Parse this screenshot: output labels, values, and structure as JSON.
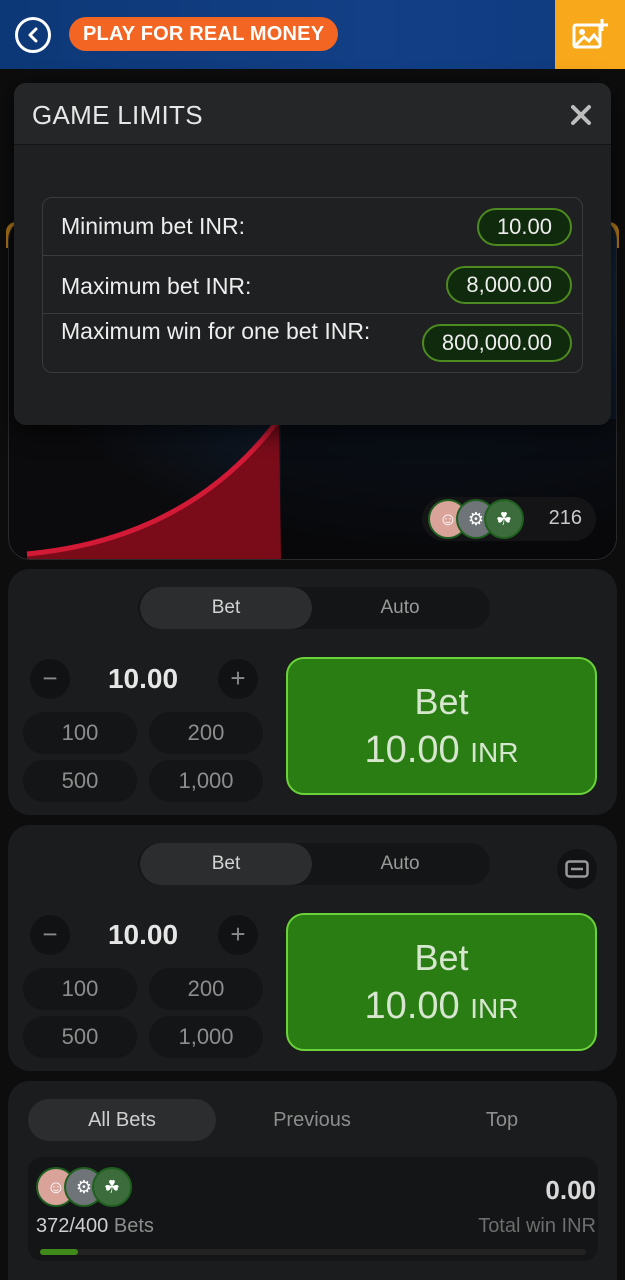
{
  "header": {
    "promo_label": "PLAY FOR REAL MONEY",
    "back_icon": "back-arrow-icon",
    "gallery_icon": "gallery-add-icon",
    "colors": {
      "bar": "#0d3877",
      "promo": "#f26522",
      "gallery": "#f7a81b"
    }
  },
  "game": {
    "players_count": "216"
  },
  "modal": {
    "title": "GAME LIMITS",
    "limits": [
      {
        "label": "Minimum bet INR:",
        "value": "10.00"
      },
      {
        "label": "Maximum bet INR:",
        "value": "8,000.00"
      },
      {
        "label": "Maximum win for one bet INR:",
        "value": "800,000.00"
      }
    ]
  },
  "bet_panels": [
    {
      "tab_bet": "Bet",
      "tab_auto": "Auto",
      "amount": "10.00",
      "chips": [
        "100",
        "200",
        "500",
        "1,000"
      ],
      "button_label": "Bet",
      "button_amount": "10.00",
      "button_currency": "INR"
    },
    {
      "tab_bet": "Bet",
      "tab_auto": "Auto",
      "amount": "10.00",
      "chips": [
        "100",
        "200",
        "500",
        "1,000"
      ],
      "button_label": "Bet",
      "button_amount": "10.00",
      "button_currency": "INR"
    }
  ],
  "bets_list": {
    "tabs": [
      "All Bets",
      "Previous",
      "Top"
    ],
    "bets_count": "372/400",
    "bets_suffix": "Bets",
    "total_win": "0.00",
    "total_win_label": "Total win INR",
    "progress": 0.07
  }
}
